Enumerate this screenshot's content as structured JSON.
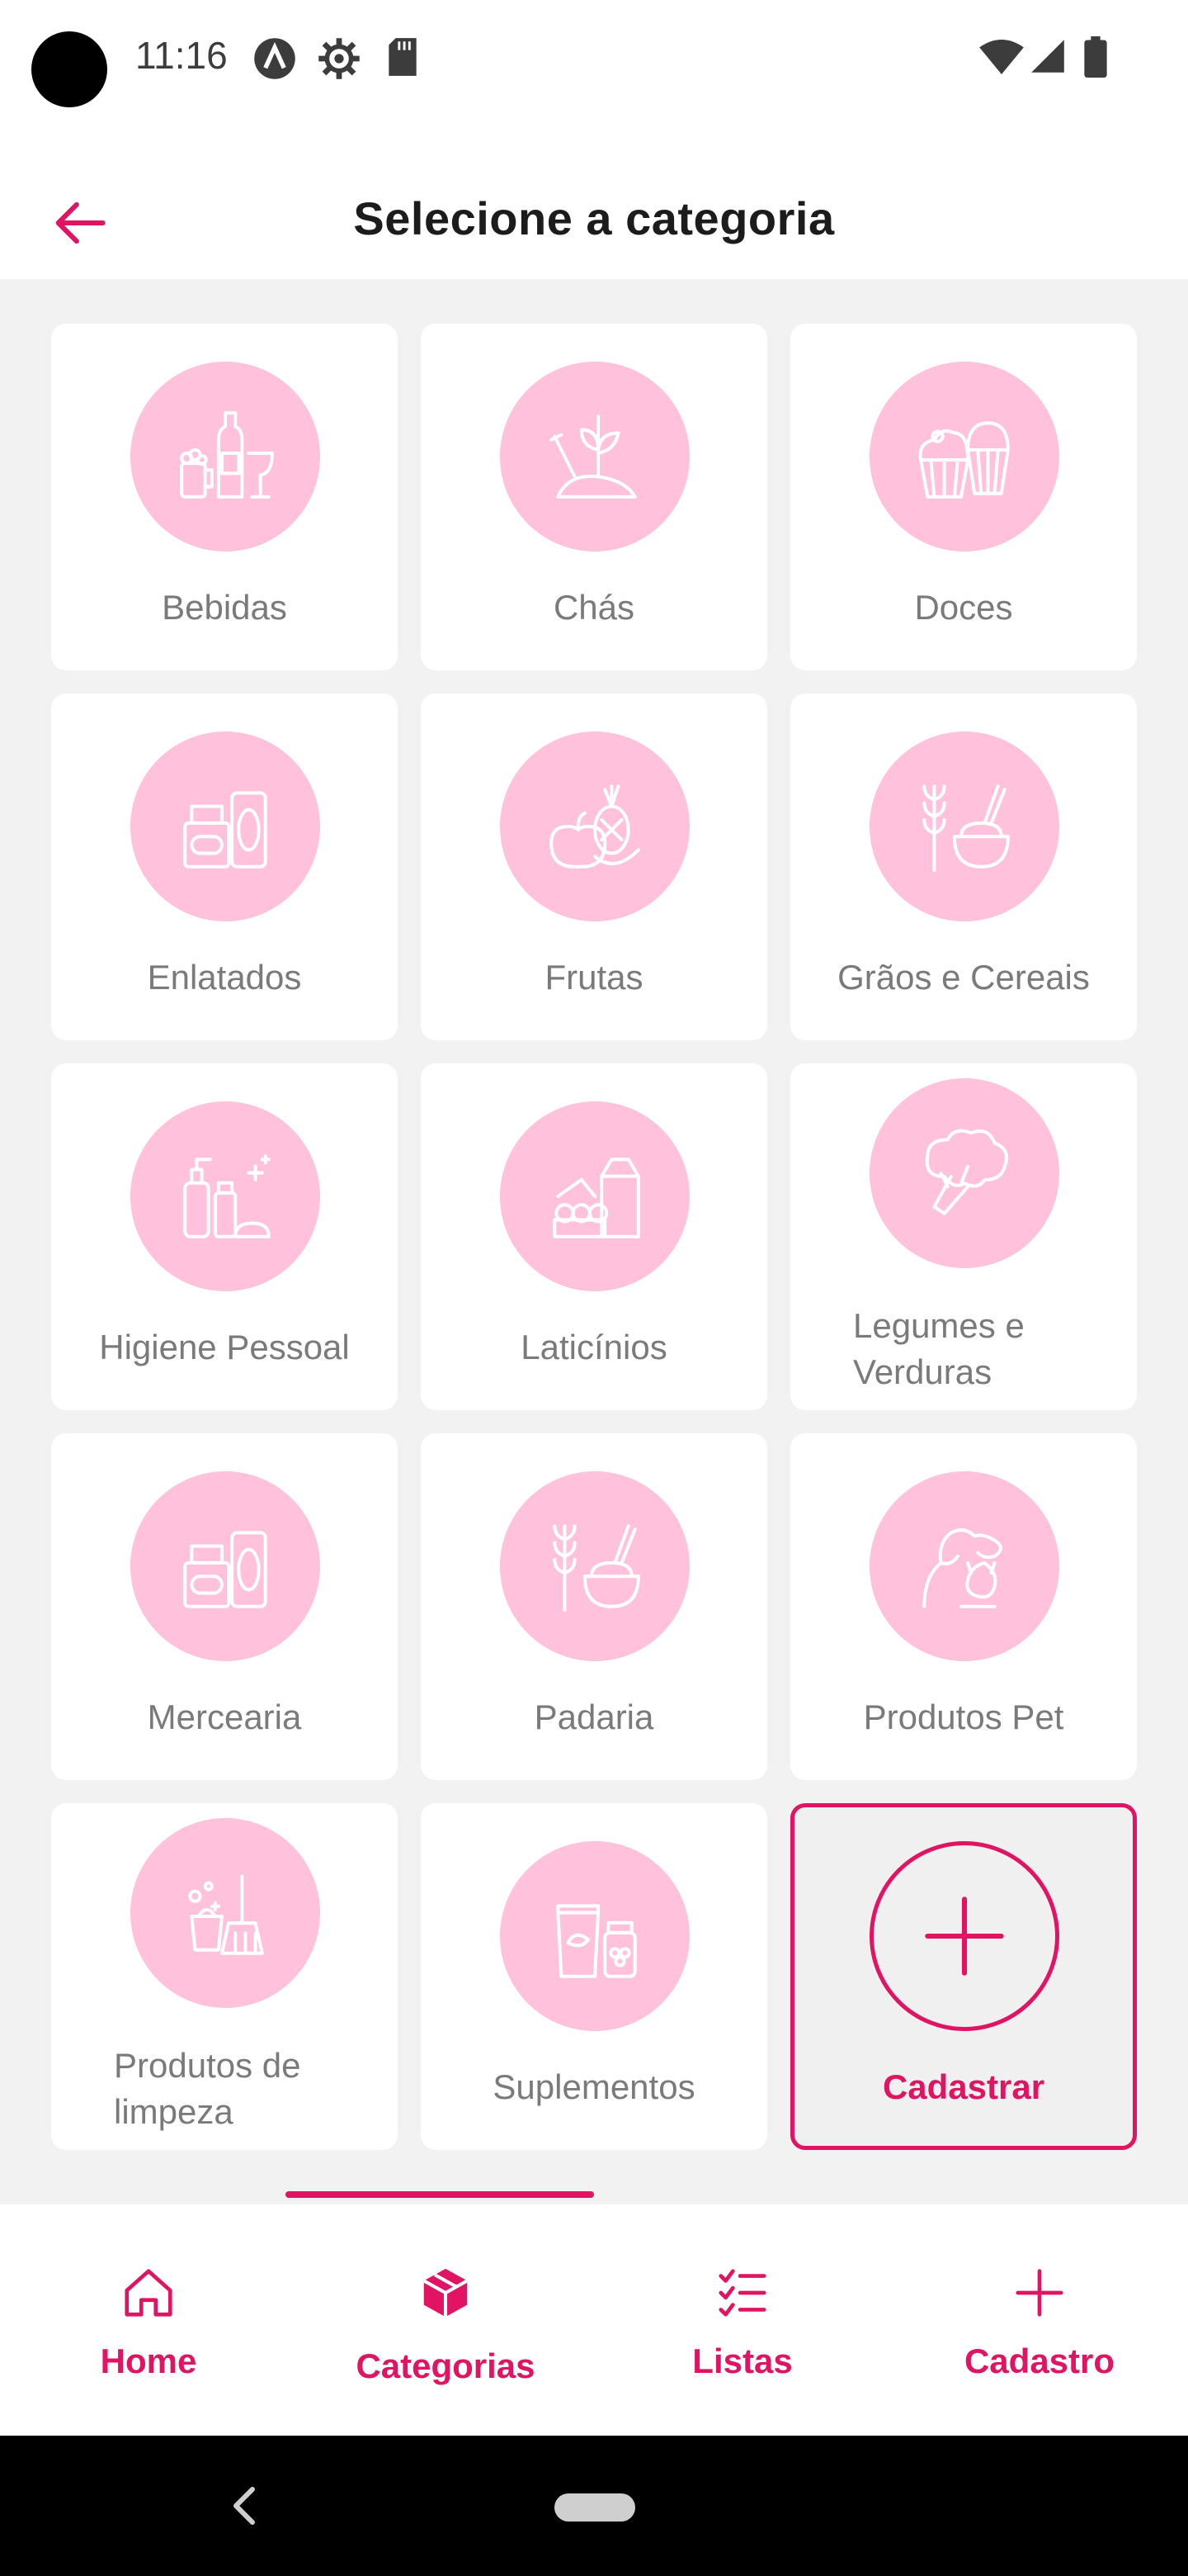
{
  "status_bar": {
    "time": "11:16",
    "left_icons": [
      "assistant-icon",
      "settings-gear-icon",
      "sd-card-icon"
    ],
    "right_icons": [
      "wifi-icon",
      "signal-icon",
      "battery-icon"
    ]
  },
  "app_bar": {
    "title": "Selecione a categoria",
    "back_icon": "arrow-left-icon"
  },
  "categories": [
    {
      "label": "Bebidas",
      "icon": "drinks-icon"
    },
    {
      "label": "Chás",
      "icon": "tea-plant-icon"
    },
    {
      "label": "Doces",
      "icon": "cupcake-icon"
    },
    {
      "label": "Enlatados",
      "icon": "canned-food-icon"
    },
    {
      "label": "Frutas",
      "icon": "fruits-icon"
    },
    {
      "label": "Grãos e Cereais",
      "icon": "grain-bowl-icon"
    },
    {
      "label": "Higiene Pessoal",
      "icon": "hygiene-bottles-icon"
    },
    {
      "label": "Laticínios",
      "icon": "dairy-icon"
    },
    {
      "label": "Legumes e Verduras",
      "icon": "broccoli-icon"
    },
    {
      "label": "Mercearia",
      "icon": "canned-food-icon"
    },
    {
      "label": "Padaria",
      "icon": "grain-bowl-icon"
    },
    {
      "label": "Produtos Pet",
      "icon": "pet-dog-cat-icon"
    },
    {
      "label": "Produtos de limpeza",
      "icon": "cleaning-icon"
    },
    {
      "label": "Suplementos",
      "icon": "supplements-icon"
    }
  ],
  "add_card": {
    "label": "Cadastrar",
    "icon": "plus-icon"
  },
  "bottom_nav": {
    "items": [
      {
        "label": "Home",
        "icon": "home-icon"
      },
      {
        "label": "Categorias",
        "icon": "box-icon",
        "active": true
      },
      {
        "label": "Listas",
        "icon": "checklist-icon"
      },
      {
        "label": "Cadastro",
        "icon": "plus-icon"
      }
    ]
  },
  "colors": {
    "accent": "#e01463",
    "icon_circle": "#ffc1dc",
    "background": "#f2f2f2",
    "card": "#ffffff",
    "label_gray": "#7a7a7a"
  }
}
